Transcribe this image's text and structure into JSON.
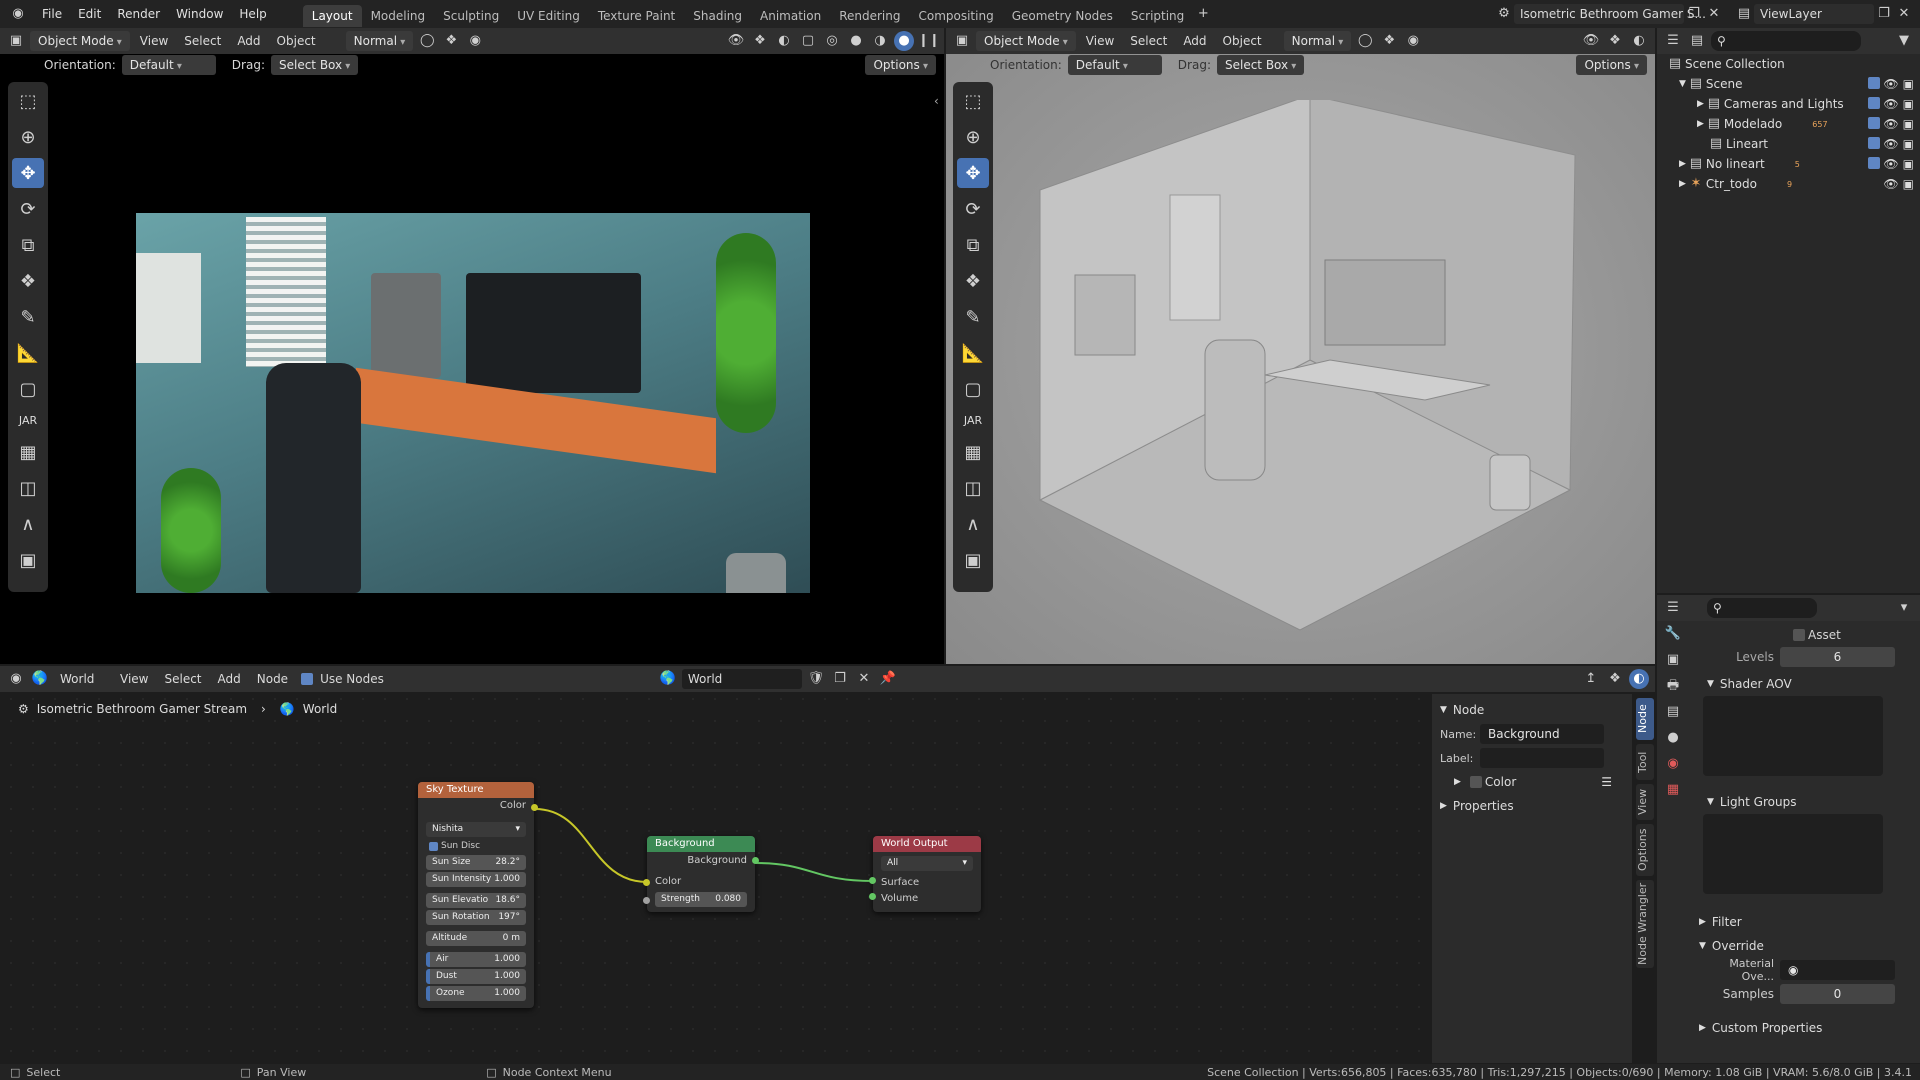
{
  "topbar": {
    "menus": [
      "File",
      "Edit",
      "Render",
      "Window",
      "Help"
    ],
    "workspaces": [
      "Layout",
      "Modeling",
      "Sculpting",
      "UV Editing",
      "Texture Paint",
      "Shading",
      "Animation",
      "Rendering",
      "Compositing",
      "Geometry Nodes",
      "Scripting"
    ],
    "active_workspace": "Layout",
    "scene_name": "Isometric Bethroom Gamer S...",
    "view_layer": "ViewLayer"
  },
  "viewport_left": {
    "mode": "Object Mode",
    "menus": [
      "View",
      "Select",
      "Add",
      "Object"
    ],
    "orientation_label": "Orientation:",
    "orientation": "Default",
    "drag_label": "Drag:",
    "drag": "Select Box",
    "shading": "Normal",
    "options": "Options",
    "jar_label": "JAR"
  },
  "viewport_right": {
    "mode": "Object Mode",
    "menus": [
      "View",
      "Select",
      "Add",
      "Object"
    ],
    "orientation_label": "Orientation:",
    "orientation": "Default",
    "drag_label": "Drag:",
    "drag": "Select Box",
    "shading": "Normal",
    "options": "Options",
    "jar_label": "JAR"
  },
  "outliner": {
    "rows": [
      {
        "label": "Scene Collection"
      },
      {
        "label": "Scene"
      },
      {
        "label": "Cameras and Lights"
      },
      {
        "label": "Modelado",
        "badge": "657"
      },
      {
        "label": "Lineart"
      },
      {
        "label": "No lineart",
        "badge": "5"
      },
      {
        "label": "Ctr_todo",
        "badge": "9"
      }
    ]
  },
  "node_editor": {
    "editor": "World",
    "menus": [
      "View",
      "Select",
      "Add",
      "Node"
    ],
    "use_nodes": "Use Nodes",
    "world_name": "World",
    "breadcrumb": [
      "Isometric Bethroom Gamer Stream",
      "World"
    ],
    "sky": {
      "title": "Sky Texture",
      "out": "Color",
      "type": "Nishita",
      "sun_disc": "Sun Disc",
      "fields": [
        {
          "k": "Sun Size",
          "v": "28.2°"
        },
        {
          "k": "Sun Intensity",
          "v": "1.000"
        },
        {
          "k": "Sun Elevatio",
          "v": "18.6°"
        },
        {
          "k": "Sun Rotation",
          "v": "197°"
        },
        {
          "k": "Altitude",
          "v": "0 m"
        },
        {
          "k": "Air",
          "v": "1.000"
        },
        {
          "k": "Dust",
          "v": "1.000"
        },
        {
          "k": "Ozone",
          "v": "1.000"
        }
      ]
    },
    "bg": {
      "title": "Background",
      "out": "Background",
      "in_color": "Color",
      "strength_label": "Strength",
      "strength": "0.080"
    },
    "wo": {
      "title": "World Output",
      "target": "All",
      "surface": "Surface",
      "volume": "Volume"
    }
  },
  "node_sidebar": {
    "section": "Node",
    "name_label": "Name:",
    "name": "Background",
    "label_label": "Label:",
    "color": "Color",
    "properties": "Properties",
    "tabs": [
      "Node",
      "Tool",
      "View",
      "Options",
      "Node Wrangler"
    ]
  },
  "properties": {
    "asset": "Asset",
    "levels_label": "Levels",
    "levels": "6",
    "shader_aov": "Shader AOV",
    "light_groups": "Light Groups",
    "filter": "Filter",
    "override": "Override",
    "material_override": "Material Ove...",
    "samples_label": "Samples",
    "samples": "0",
    "custom_props": "Custom Properties"
  },
  "statusbar": {
    "select": "Select",
    "pan": "Pan View",
    "context": "Node Context Menu",
    "stats": "Scene Collection | Verts:656,805 | Faces:635,780 | Tris:1,297,215 | Objects:0/690 | Memory: 1.08 GiB | VRAM: 5.6/8.0 GiB | 3.4.1"
  },
  "colors": {
    "accent": "#4772b3",
    "sky_header": "#b3623c",
    "bg_header": "#3c8a54",
    "wo_header": "#9c3a46"
  }
}
